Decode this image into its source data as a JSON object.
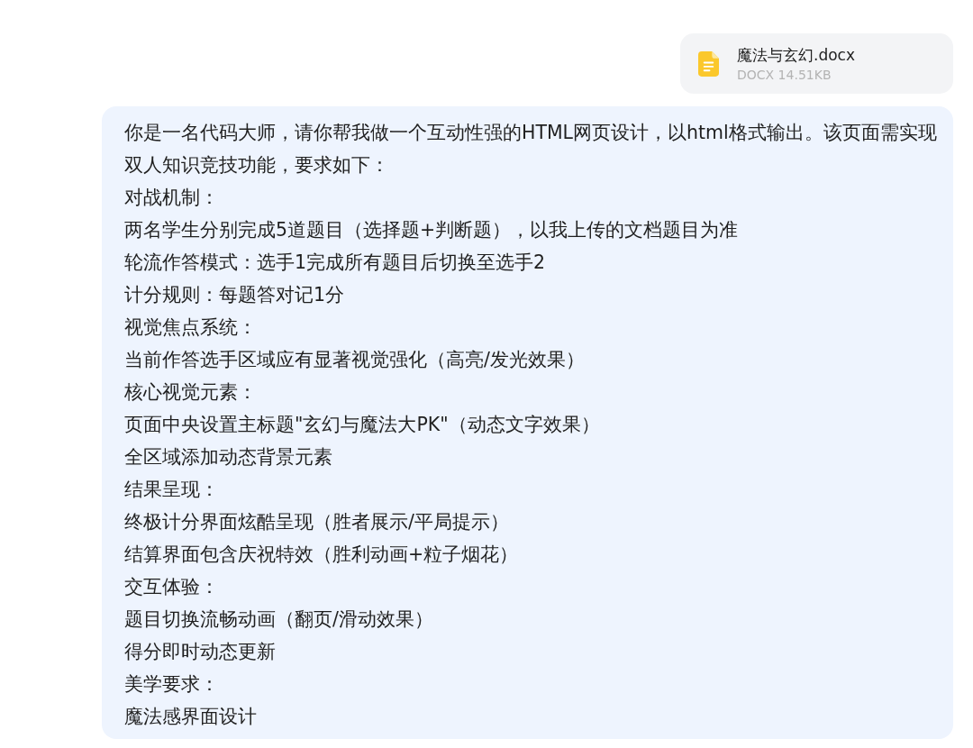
{
  "attachment": {
    "file_name": "魔法与玄幻.docx",
    "file_info": "DOCX 14.51KB"
  },
  "message": {
    "lines": [
      "你是一名代码大师，请你帮我做一个互动性强的HTML网页设计，以html格式输出。该页面需实现双人知识竞技功能，要求如下：",
      "对战机制：",
      "两名学生分别完成5道题目（选择题+判断题），以我上传的文档题目为准",
      "轮流作答模式：选手1完成所有题目后切换至选手2",
      "计分规则：每题答对记1分",
      "视觉焦点系统：",
      "当前作答选手区域应有显著视觉强化（高亮/发光效果）",
      "核心视觉元素：",
      "页面中央设置主标题\"玄幻与魔法大PK\"（动态文字效果）",
      "全区域添加动态背景元素",
      "结果呈现：",
      "终极计分界面炫酷呈现（胜者展示/平局提示）",
      "结算界面包含庆祝特效（胜利动画+粒子烟花）",
      "交互体验：",
      "题目切换流畅动画（翻页/滑动效果）",
      "得分即时动态更新",
      "美学要求：",
      "魔法感界面设计"
    ]
  }
}
